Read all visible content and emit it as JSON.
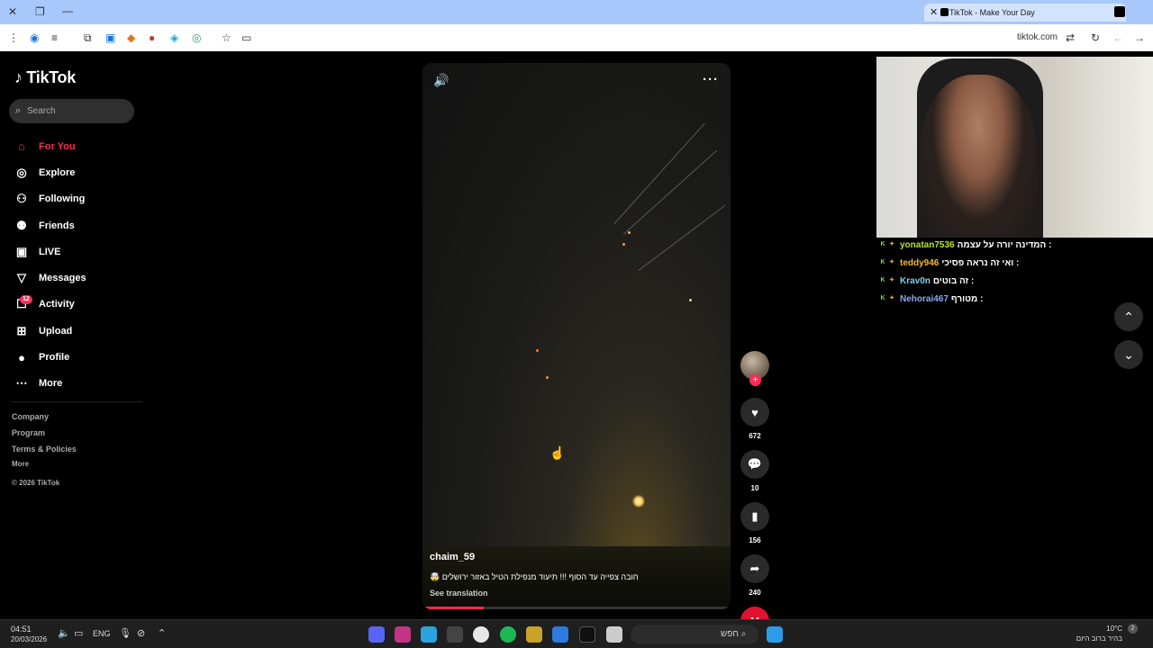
{
  "browser": {
    "tab_title": "TikTok - Make Your Day",
    "url": "tiktok.com",
    "tab_icons": [
      "close-window-icon",
      "restore-icon",
      "minimize-icon",
      "new-tab-icon"
    ]
  },
  "sidebar": {
    "logo": "TikTok",
    "search_placeholder": "Search",
    "items": [
      {
        "label": "For You",
        "icon": "home-icon",
        "glyph": "⌂",
        "active": true
      },
      {
        "label": "Explore",
        "icon": "compass-icon",
        "glyph": "◎"
      },
      {
        "label": "Following",
        "icon": "following-icon",
        "glyph": "⚇"
      },
      {
        "label": "Friends",
        "icon": "friends-icon",
        "glyph": "⚉"
      },
      {
        "label": "LIVE",
        "icon": "live-icon",
        "glyph": "▣"
      },
      {
        "label": "Messages",
        "icon": "messages-icon",
        "glyph": "▽"
      },
      {
        "label": "Activity",
        "icon": "activity-icon",
        "glyph": "☐",
        "badge": "12"
      },
      {
        "label": "Upload",
        "icon": "upload-icon",
        "glyph": "⊞"
      },
      {
        "label": "Profile",
        "icon": "profile-avatar-icon",
        "glyph": "●"
      },
      {
        "label": "More",
        "icon": "more-icon",
        "glyph": "⋯"
      }
    ],
    "footer": {
      "company": "Company",
      "program": "Program",
      "terms": "Terms & Policies",
      "more": "More",
      "copyright": "© 2026 TikTok"
    }
  },
  "video": {
    "username": "chaim_59",
    "caption": "חובה צפייה עד הסוף !!! תיעוד מנפילת הטיל באזור ירושלים 🤯",
    "see_translation": "See translation",
    "progress": 0.2
  },
  "actions": {
    "likes": "672",
    "comments": "10",
    "saves": "156",
    "shares": "240",
    "brand_letter": "y"
  },
  "chat": [
    {
      "user": "yonatan7536",
      "message": ": המדינה יורה על עצמה",
      "color": "#b5e61d"
    },
    {
      "user": "teddy946",
      "message": ": ואי זה נראה פסיכי",
      "color": "#f5b83d"
    },
    {
      "user": "Krav0n",
      "message": ": זה בוטים",
      "color": "#7ad0f0"
    },
    {
      "user": "Nehorai467",
      "message": ": מטורף",
      "color": "#8aa8f0"
    }
  ],
  "taskbar": {
    "time": "04:51",
    "date": "20/03/2026",
    "lang": "ENG",
    "search_placeholder": "חפש",
    "weather_temp": "10°C",
    "weather_desc": "בהיר ברוב היום",
    "notif_count": "2"
  },
  "colors": {
    "accent": "#fe2c55",
    "chrome_tab_bg": "#a8c7fa"
  }
}
